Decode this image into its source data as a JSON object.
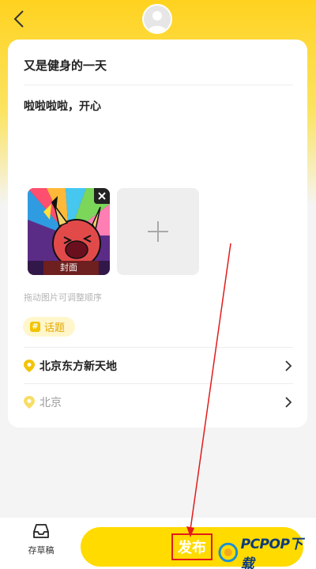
{
  "header": {
    "back_icon": "chevron-left-icon",
    "avatar_icon": "user-avatar-icon"
  },
  "post": {
    "title": "又是健身的一天",
    "body": "啦啦啦啦，开心"
  },
  "media": {
    "cover_label": "封面",
    "remove_icon": "close-icon",
    "add_icon": "plus-icon",
    "hint": "拖动图片可调整顺序"
  },
  "topic": {
    "badge": "#",
    "label": "话题"
  },
  "location": {
    "place": "北京东方新天地",
    "city": "北京"
  },
  "footer": {
    "draft_label": "存草稿",
    "publish_label": "发布"
  },
  "watermark": {
    "text": "PCPOP下载"
  },
  "colors": {
    "brand_yellow": "#ffdb00",
    "annotation_red": "#e21b1b",
    "pin_yellow": "#f3c300"
  }
}
